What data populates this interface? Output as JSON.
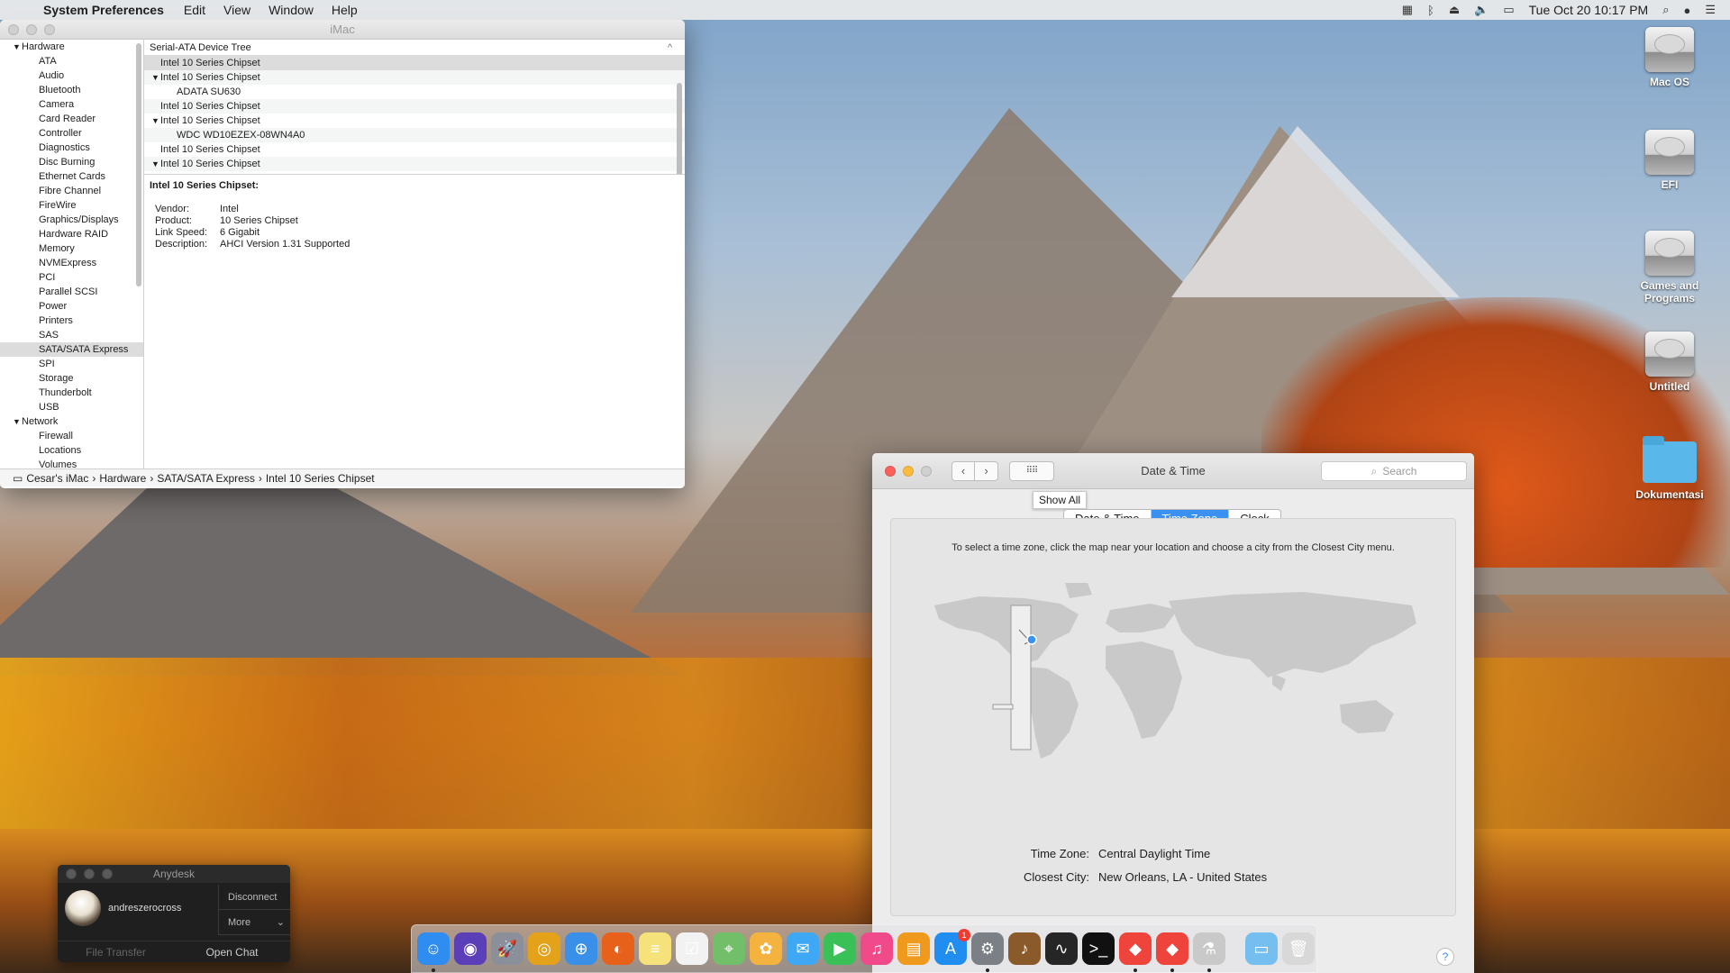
{
  "menubar": {
    "app_name": "System Preferences",
    "menus": [
      "Edit",
      "View",
      "Window",
      "Help"
    ],
    "clock": "Tue Oct 20  10:17 PM"
  },
  "desktop_icons": [
    "Mac OS",
    "EFI",
    "Games and Programs",
    "Untitled",
    "Dokumentasi"
  ],
  "sysinfo": {
    "title": "iMac",
    "sidebar": {
      "hardware_label": "Hardware",
      "hardware_items": [
        "ATA",
        "Audio",
        "Bluetooth",
        "Camera",
        "Card Reader",
        "Controller",
        "Diagnostics",
        "Disc Burning",
        "Ethernet Cards",
        "Fibre Channel",
        "FireWire",
        "Graphics/Displays",
        "Hardware RAID",
        "Memory",
        "NVMExpress",
        "PCI",
        "Parallel SCSI",
        "Power",
        "Printers",
        "SAS",
        "SATA/SATA Express",
        "SPI",
        "Storage",
        "Thunderbolt",
        "USB"
      ],
      "network_label": "Network",
      "network_items": [
        "Firewall",
        "Locations",
        "Volumes"
      ]
    },
    "tree_header": "Serial-ATA Device Tree",
    "tree_rows": [
      {
        "label": "Intel 10 Series Chipset",
        "level": 0,
        "expanded": false,
        "selected": true
      },
      {
        "label": "Intel 10 Series Chipset",
        "level": 0,
        "expanded": true,
        "selected": false
      },
      {
        "label": "ADATA SU630",
        "level": 1,
        "expanded": false,
        "selected": false
      },
      {
        "label": "Intel 10 Series Chipset",
        "level": 0,
        "expanded": false,
        "selected": false
      },
      {
        "label": "Intel 10 Series Chipset",
        "level": 0,
        "expanded": true,
        "selected": false
      },
      {
        "label": "WDC WD10EZEX-08WN4A0",
        "level": 1,
        "expanded": false,
        "selected": false
      },
      {
        "label": "Intel 10 Series Chipset",
        "level": 0,
        "expanded": false,
        "selected": false
      },
      {
        "label": "Intel 10 Series Chipset",
        "level": 0,
        "expanded": true,
        "selected": false
      }
    ],
    "info": {
      "title": "Intel 10 Series Chipset:",
      "rows": [
        {
          "k": "Vendor:",
          "v": "Intel"
        },
        {
          "k": "Product:",
          "v": "10 Series Chipset"
        },
        {
          "k": "Link Speed:",
          "v": "6 Gigabit"
        },
        {
          "k": "Description:",
          "v": "AHCI Version 1.31 Supported"
        }
      ]
    },
    "path": [
      "Cesar's iMac",
      "Hardware",
      "SATA/SATA Express",
      "Intel 10 Series Chipset"
    ]
  },
  "datetime": {
    "title": "Date & Time",
    "search_placeholder": "Search",
    "tooltip": "Show All",
    "tabs": [
      "Date & Time",
      "Time Zone",
      "Clock"
    ],
    "active_tab": "Time Zone",
    "instruction": "To select a time zone, click the map near your location and choose a city from the Closest City menu.",
    "time_zone_label": "Time Zone:",
    "time_zone_value": "Central Daylight Time",
    "closest_city_label": "Closest City:",
    "closest_city_value": "New Orleans, LA - United States",
    "help": "?"
  },
  "anydesk": {
    "title": "Anydesk",
    "user": "andreszerocross",
    "disconnect": "Disconnect",
    "more": "More",
    "file_transfer": "File Transfer",
    "open_chat": "Open Chat"
  },
  "dock": {
    "apps": [
      {
        "name": "finder-icon",
        "color": "#2f8cf0",
        "glyph": "☺",
        "running": true
      },
      {
        "name": "siri-icon",
        "color": "#5a3fb8",
        "glyph": "◉",
        "running": false
      },
      {
        "name": "launchpad-icon",
        "color": "#8a8f9a",
        "glyph": "🚀",
        "running": false
      },
      {
        "name": "chrome-icon",
        "color": "#e3a21a",
        "glyph": "◎",
        "running": false
      },
      {
        "name": "safari-icon",
        "color": "#3a8fe8",
        "glyph": "⊕",
        "running": false
      },
      {
        "name": "firefox-icon",
        "color": "#e8611a",
        "glyph": "◐",
        "running": false
      },
      {
        "name": "notes-icon",
        "color": "#f5e27a",
        "glyph": "≡",
        "running": false
      },
      {
        "name": "reminders-icon",
        "color": "#f2f2f2",
        "glyph": "☑",
        "running": false
      },
      {
        "name": "maps-icon",
        "color": "#72bf6a",
        "glyph": "⌖",
        "running": false
      },
      {
        "name": "photos-icon",
        "color": "#f4b23e",
        "glyph": "✿",
        "running": false
      },
      {
        "name": "messages-icon",
        "color": "#3ea8f4",
        "glyph": "✉",
        "running": false
      },
      {
        "name": "facetime-icon",
        "color": "#39c158",
        "glyph": "▶",
        "running": false
      },
      {
        "name": "itunes-icon",
        "color": "#f14a8b",
        "glyph": "♫",
        "running": false
      },
      {
        "name": "ibooks-icon",
        "color": "#f09a1d",
        "glyph": "▤",
        "running": false
      },
      {
        "name": "app-store-icon",
        "color": "#1f8ef0",
        "glyph": "A",
        "running": false,
        "badge": "1"
      },
      {
        "name": "system-preferences-icon",
        "color": "#7b7f86",
        "glyph": "⚙",
        "running": true
      },
      {
        "name": "garageband-icon",
        "color": "#8a5a2b",
        "glyph": "♪",
        "running": false
      },
      {
        "name": "activity-monitor-icon",
        "color": "#262626",
        "glyph": "∿",
        "running": false
      },
      {
        "name": "terminal-icon",
        "color": "#111111",
        "glyph": ">_",
        "running": false
      },
      {
        "name": "anydesk-icon",
        "color": "#ef443b",
        "glyph": "◆",
        "running": true
      },
      {
        "name": "anydesk-2-icon",
        "color": "#ef443b",
        "glyph": "◆",
        "running": true
      },
      {
        "name": "system-information-icon",
        "color": "#c9c9c9",
        "glyph": "⚗",
        "running": true
      }
    ],
    "folder": {
      "name": "downloads-folder-icon",
      "color": "#74bff0",
      "glyph": "▭"
    },
    "trash": {
      "name": "trash-icon",
      "color": "#d8d8d8",
      "glyph": "🗑"
    }
  }
}
